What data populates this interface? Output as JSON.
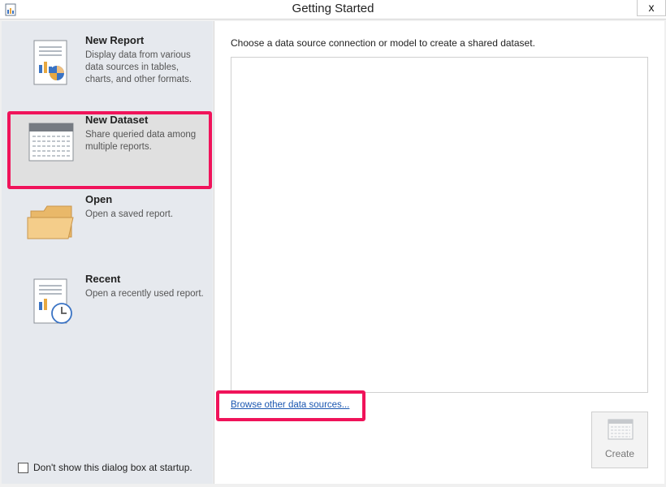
{
  "window": {
    "title": "Getting Started",
    "close_label": "x"
  },
  "sidebar": {
    "items": [
      {
        "label": "New Report",
        "description": "Display data from various data sources in tables, charts, and other formats.",
        "icon": "report-icon",
        "selected": false
      },
      {
        "label": "New Dataset",
        "description": "Share queried data among multiple reports.",
        "icon": "dataset-icon",
        "selected": true
      },
      {
        "label": "Open",
        "description": "Open a saved report.",
        "icon": "folder-icon",
        "selected": false
      },
      {
        "label": "Recent",
        "description": "Open a recently used report.",
        "icon": "recent-icon",
        "selected": false
      }
    ],
    "startup_checkbox": {
      "label": "Don't show this dialog box at startup.",
      "checked": false
    }
  },
  "main": {
    "instruction": "Choose a data source connection or model to create a shared dataset.",
    "browse_link": "Browse other data sources...",
    "create_button": {
      "label": "Create",
      "enabled": false
    }
  },
  "colors": {
    "highlight": "#f0135a",
    "link": "#1a56b0",
    "sidebar_bg": "#e6e9ee",
    "selected_bg": "#e0e0e0"
  }
}
